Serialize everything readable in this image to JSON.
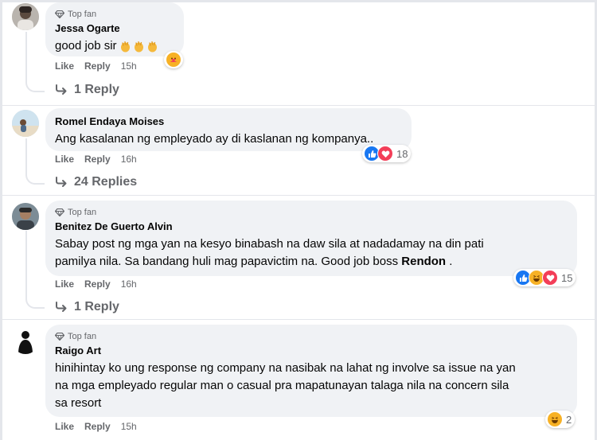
{
  "comments": [
    {
      "badge": "Top fan",
      "author": "Jessa Ogarte",
      "text": "good job sir",
      "actions": {
        "like": "Like",
        "reply": "Reply",
        "time": "15h"
      },
      "replies": "1 Reply"
    },
    {
      "badge": "",
      "author": "Romel Endaya Moises",
      "text": "Ang kasalanan ng empleyado ay di kaslanan ng kompanya..",
      "actions": {
        "like": "Like",
        "reply": "Reply",
        "time": "16h"
      },
      "reaction_count": "18",
      "replies": "24 Replies"
    },
    {
      "badge": "Top fan",
      "author": "Benitez De Guerto Alvin",
      "text_line1": "Sabay post ng mga yan na kesyo binabash na daw sila at nadadamay na din pati",
      "text_line2_pre": "pamilya nila. Sa bandang huli mag papavictim na. Good job boss ",
      "text_line2_tag": "Rendon",
      "text_line2_post": " .",
      "actions": {
        "like": "Like",
        "reply": "Reply",
        "time": "16h"
      },
      "reaction_count": "15",
      "replies": "1 Reply"
    },
    {
      "badge": "Top fan",
      "author": "Raigo Art",
      "text_line1": "hinihintay ko ung response ng company na nasibak na lahat ng involve sa issue na yan",
      "text_line2": "na mga empleyado regular man o casual pra mapatunayan talaga nila na concern sila",
      "text_line3": "sa resort",
      "actions": {
        "like": "Like",
        "reply": "Reply",
        "time": "15h"
      },
      "reaction_count": "2"
    }
  ],
  "colors": {
    "bubble": "#f0f2f5",
    "secondary_text": "#65676b",
    "like_blue": "#1877f2",
    "love_red": "#f33e58",
    "haha_yellow": "#f7b125"
  },
  "icons": [
    "diamond-icon",
    "reply-arrow-icon",
    "clap-emoji",
    "like-icon",
    "love-icon",
    "haha-icon",
    "care-icon"
  ]
}
